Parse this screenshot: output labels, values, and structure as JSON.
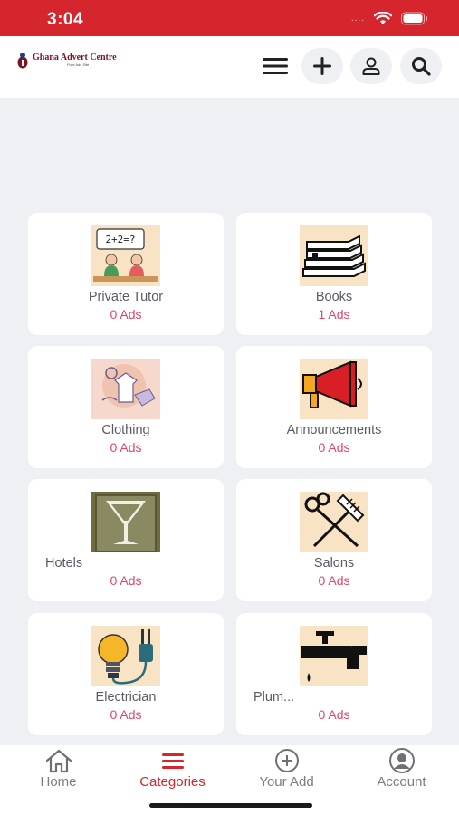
{
  "status": {
    "time": "3:04",
    "signal": "....",
    "color": "#d5262d"
  },
  "header": {
    "logo_title": "Ghana Advert Centre",
    "logo_tagline": "Pure Ads Site",
    "icons": [
      "menu-icon",
      "plus-icon",
      "user-icon",
      "search-icon"
    ]
  },
  "categories": [
    {
      "name": "Private Tutor",
      "count": "0 Ads",
      "image": "private-tutor-image"
    },
    {
      "name": "Books",
      "count": "1 Ads",
      "image": "books-image"
    },
    {
      "name": "Clothing",
      "count": "0 Ads",
      "image": "clothing-image"
    },
    {
      "name": "Announcements",
      "count": "0 Ads",
      "image": "announcements-image"
    },
    {
      "name": "Hotels",
      "count": "0 Ads",
      "image": "hotels-image"
    },
    {
      "name": "Salons",
      "count": "0 Ads",
      "image": "salons-image"
    },
    {
      "name": "Electrician",
      "count": "0 Ads",
      "image": "electrician-image"
    },
    {
      "name": "Plum...",
      "count": "0 Ads",
      "image": "plumbing-image"
    }
  ],
  "nav": [
    {
      "label": "Home",
      "icon": "home-icon",
      "active": false
    },
    {
      "label": "Categories",
      "icon": "categories-icon",
      "active": true
    },
    {
      "label": "Your Add",
      "icon": "add-circle-icon",
      "active": false
    },
    {
      "label": "Account",
      "icon": "account-icon",
      "active": false
    }
  ],
  "colors": {
    "accent": "#d5262d",
    "count": "#e0456a",
    "background": "#eef0f4"
  }
}
